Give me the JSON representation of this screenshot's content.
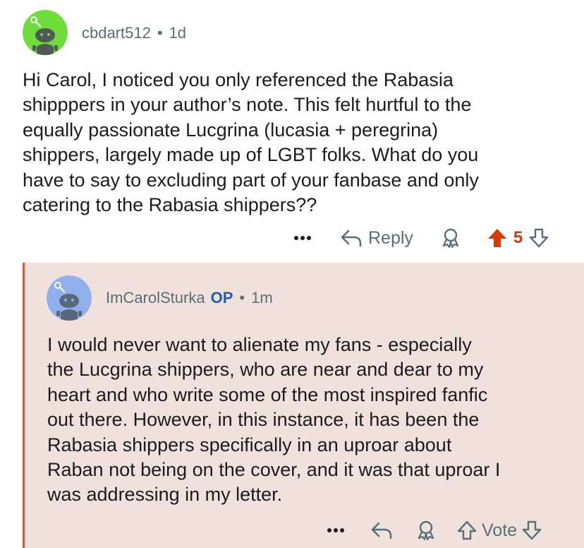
{
  "comment": {
    "username": "cbdart512",
    "time": "1d",
    "body": "Hi Carol, I noticed you only referenced the Rabasia\nshipppers in your author’s note. This felt hurtful to the\nequally passionate Lucgrina (lucasia + peregrina)\nshippers, largely made up of LGBT folks. What do you\nhave to say to excluding part of your fanbase and only\ncatering to the Rabasia shippers??",
    "actions": {
      "more_icon": "ellipsis-icon",
      "reply_label": "Reply",
      "award_icon": "award-icon",
      "upvote_icon": "arrow-up-icon",
      "score": "5",
      "downvote_icon": "arrow-down-icon"
    },
    "avatar_color": "#6fdc3c"
  },
  "reply": {
    "username": "ImCarolSturka",
    "op_badge": "OP",
    "time": "1m",
    "body": "I would never want to alienate my fans - especially\nthe Lucgrina shippers, who are near and dear to my\nheart and who write some of the most inspired fanfic\nout there. However, in this instance, it has been the\nRabasia shippers specifically in an uproar about\nRaban not being on the cover, and it was that uproar I\nwas addressing in my letter.",
    "actions": {
      "more_icon": "ellipsis-icon",
      "reply_icon": "reply-arrow-icon",
      "award_icon": "award-icon",
      "upvote_icon": "arrow-up-icon",
      "vote_label": "Vote",
      "downvote_icon": "arrow-down-icon"
    },
    "avatar_color": "#8fb0ec",
    "highlight_color": "#f0e1dd",
    "thread_line_color": "#e9542e"
  },
  "colors": {
    "meta": "#576f76",
    "upvoted": "#d93a00",
    "op_badge": "#1c5eb8"
  }
}
